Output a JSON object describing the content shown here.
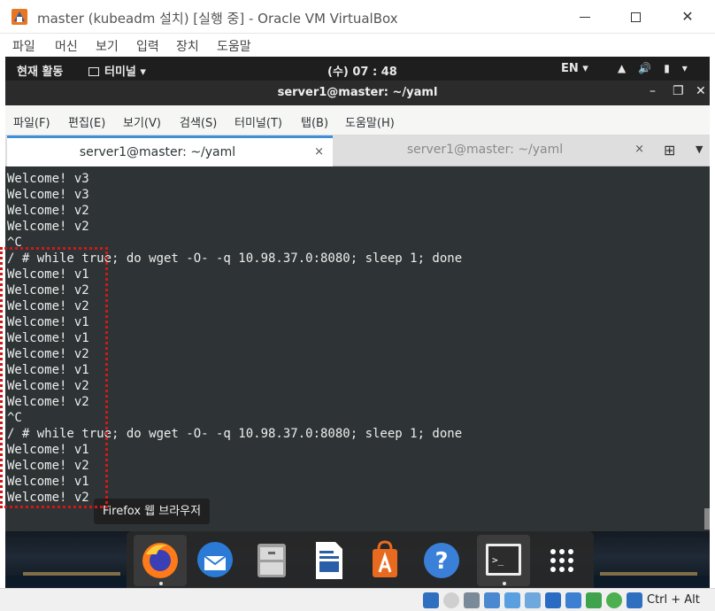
{
  "vbox": {
    "title": "master (kubeadm 설치) [실행 중] - Oracle VM VirtualBox",
    "menu": [
      "파일",
      "머신",
      "보기",
      "입력",
      "장치",
      "도움말"
    ],
    "host_key": "Ctrl + Alt"
  },
  "gnome": {
    "activities": "현재 활동",
    "app_menu": "터미널 ▾",
    "clock": "(수) 07 : 48",
    "lang": "EN ▾"
  },
  "terminal": {
    "window_title": "server1@master: ~/yaml",
    "menu": [
      "파일(F)",
      "편집(E)",
      "보기(V)",
      "검색(S)",
      "터미널(T)",
      "탭(B)",
      "도움말(H)"
    ],
    "tabs": [
      {
        "label": "server1@master: ~/yaml",
        "close": "×"
      },
      {
        "label": "server1@master: ~/yaml",
        "close": "×"
      }
    ],
    "lines": [
      "Welcome! v3",
      "Welcome! v3",
      "Welcome! v2",
      "Welcome! v2",
      "^C",
      "/ # while true; do wget -O- -q 10.98.37.0:8080; sleep 1; done",
      "Welcome! v1",
      "Welcome! v2",
      "Welcome! v2",
      "Welcome! v1",
      "Welcome! v1",
      "Welcome! v2",
      "Welcome! v1",
      "Welcome! v2",
      "Welcome! v2",
      "^C",
      "/ # while true; do wget -O- -q 10.98.37.0:8080; sleep 1; done",
      "Welcome! v1",
      "Welcome! v2",
      "Welcome! v1",
      "Welcome! v2"
    ]
  },
  "dock": {
    "tooltip": "Firefox 웹 브라우저",
    "items": [
      "firefox-icon",
      "thunderbird-icon",
      "files-icon",
      "libreoffice-writer-icon",
      "software-center-icon",
      "help-icon",
      "terminal-icon",
      "app-grid-icon"
    ],
    "help_glyph": "?",
    "terminal_glyph": ">_"
  },
  "colors": {
    "terminal_bg": "#2e3436",
    "terminal_fg": "#eeeeec",
    "annotation_box": "#d01818",
    "tab_accent": "#3d8fd6"
  }
}
